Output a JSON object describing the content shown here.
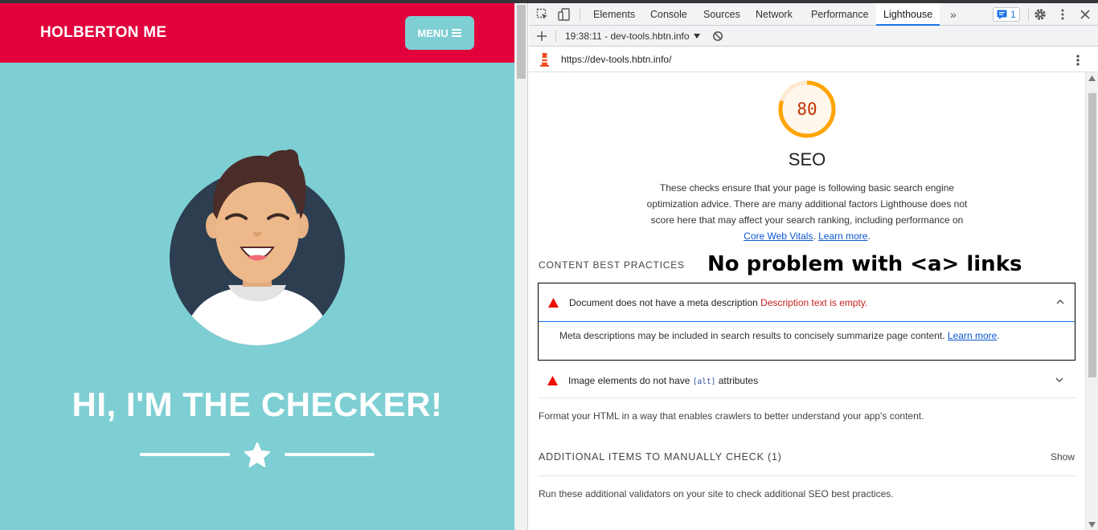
{
  "site": {
    "brand": "HOLBERTON ME",
    "menu_label": "MENU",
    "hero_title": "HI, I'M THE CHECKER!",
    "colors": {
      "header": "#e1003c",
      "body": "#7ecfd3"
    }
  },
  "devtools": {
    "tabs": [
      "Elements",
      "Console",
      "Sources",
      "Network",
      "Performance",
      "Lighthouse"
    ],
    "active_tab": "Lighthouse",
    "issues_count": "1",
    "report_selector": "19:38:11 - dev-tools.hbtn.info",
    "report_url": "https://dev-tools.hbtn.info/"
  },
  "report": {
    "score": "80",
    "score_fraction": 0.8,
    "category_title": "SEO",
    "category_description": "These checks ensure that your page is following basic search engine optimization advice. There are many additional factors Lighthouse does not score here that may affect your search ranking, including performance on",
    "link_core_web_vitals": "Core Web Vitals",
    "link_learn_more": "Learn more",
    "group_title": "CONTENT BEST PRACTICES",
    "overlay_note": "No problem with <a> links",
    "audit_meta_title": "Document does not have a meta description",
    "audit_meta_display": "Description text is empty.",
    "audit_meta_description": "Meta descriptions may be included in search results to concisely summarize page content.",
    "audit_meta_link": "Learn more",
    "audit_alt_title_before": "Image elements do not have",
    "audit_alt_code": "[alt]",
    "audit_alt_title_after": "attributes",
    "group_description": "Format your HTML in a way that enables crawlers to better understand your app's content.",
    "manual_title": "ADDITIONAL ITEMS TO MANUALLY CHECK (1)",
    "manual_show": "Show",
    "manual_description": "Run these additional validators on your site to check additional SEO best practices."
  }
}
